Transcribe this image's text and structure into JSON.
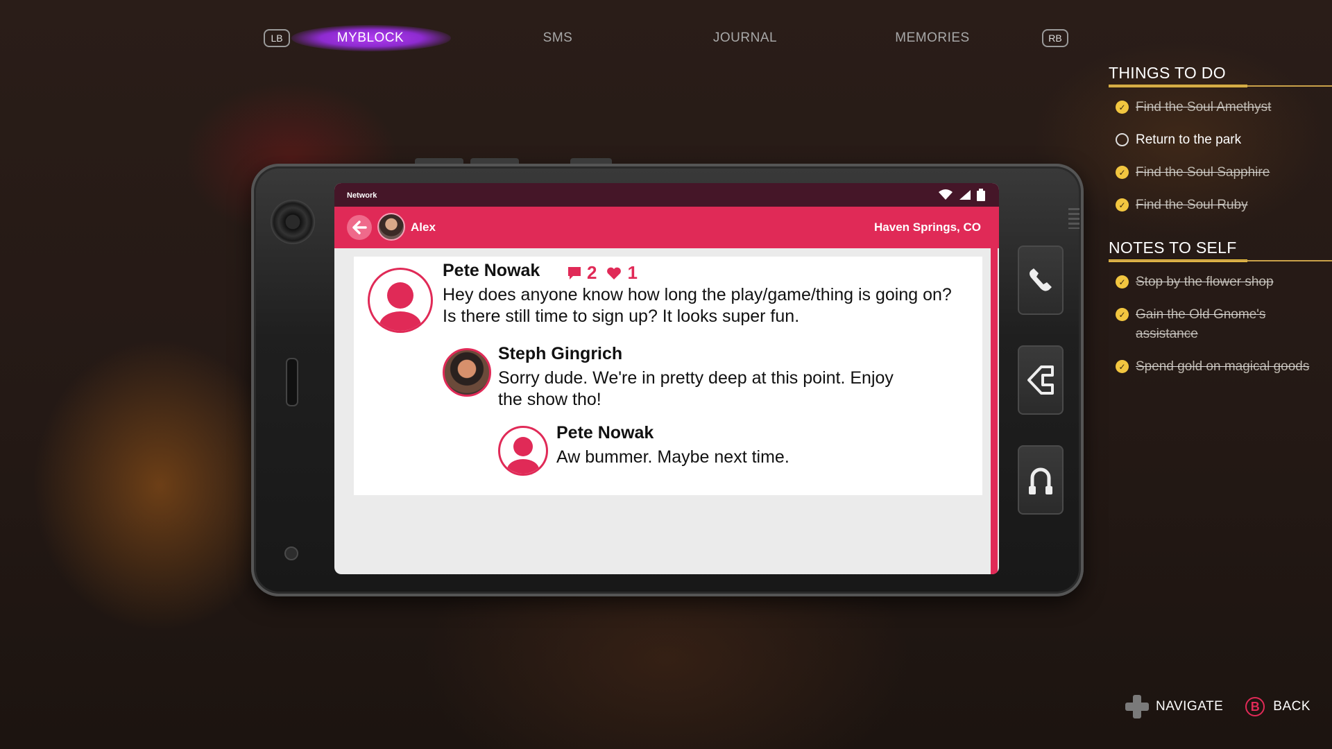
{
  "top_nav": {
    "left_bumper": "LB",
    "right_bumper": "RB",
    "tabs": [
      {
        "label": "MYBLOCK",
        "active": true
      },
      {
        "label": "SMS",
        "active": false
      },
      {
        "label": "JOURNAL",
        "active": false
      },
      {
        "label": "MEMORIES",
        "active": false
      }
    ]
  },
  "phone": {
    "status_bar": {
      "network": "Network"
    },
    "app_bar": {
      "user_name": "Alex",
      "location": "Haven Springs, CO"
    },
    "post": {
      "author": "Pete Nowak",
      "comment_count": "2",
      "like_count": "1",
      "text_line1": "Hey does anyone know how long the play/game/thing is going on?",
      "text_line2": "Is there still time to sign up? It looks super fun."
    },
    "reply1": {
      "author": "Steph Gingrich",
      "text_line1": "Sorry dude. We're in pretty deep at this point. Enjoy",
      "text_line2": "the show tho!"
    },
    "reply2": {
      "author": "Pete Nowak",
      "text": "Aw bummer. Maybe next time."
    },
    "side_buttons": [
      "phone-icon",
      "home-icon",
      "headphones-icon"
    ]
  },
  "things_to_do": {
    "title": "THINGS TO DO",
    "items": [
      {
        "text": "Find the Soul Amethyst",
        "done": true
      },
      {
        "text": "Return to the park",
        "done": false
      },
      {
        "text": "Find the Soul Sapphire",
        "done": true
      },
      {
        "text": "Find the Soul Ruby",
        "done": true
      }
    ]
  },
  "notes_to_self": {
    "title": "NOTES TO SELF",
    "items": [
      {
        "text": "Stop by the flower shop",
        "done": true
      },
      {
        "text": "Gain the Old Gnome's assistance",
        "done": true
      },
      {
        "text": "Spend gold on magical goods",
        "done": true
      }
    ]
  },
  "prompts": {
    "navigate": "NAVIGATE",
    "back_button": "B",
    "back": "BACK"
  },
  "colors": {
    "accent": "#e02a57",
    "tab_glow": "#b03cf0",
    "check": "#f2c640"
  }
}
